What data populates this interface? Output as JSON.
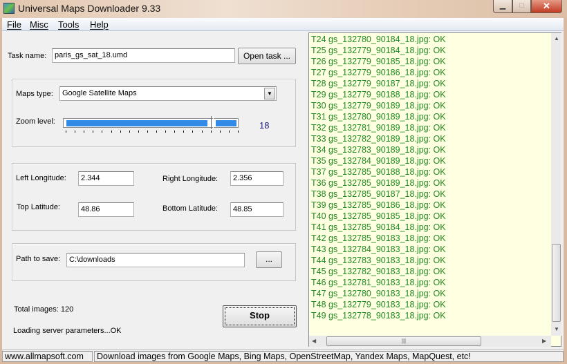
{
  "window": {
    "title": "Universal Maps Downloader 9.33",
    "minimize": "▁",
    "maximize": "□",
    "close": "✕"
  },
  "menu": [
    "File",
    "Misc",
    "Tools",
    "Help"
  ],
  "task": {
    "label": "Task name:",
    "value": "paris_gs_sat_18.umd",
    "open_button": "Open task ..."
  },
  "maps": {
    "type_label": "Maps type:",
    "type_value": "Google Satellite Maps",
    "zoom_label": "Zoom level:",
    "zoom_value": "18",
    "zoom_min": 0,
    "zoom_max": 19,
    "colors": {
      "slider_fill": "#3289e6",
      "zoom_value": "#1a1a80"
    }
  },
  "coords": {
    "left_lon_label": "Left Longitude:",
    "left_lon": "2.344",
    "right_lon_label": "Right Longitude:",
    "right_lon": "2.356",
    "top_lat_label": "Top Latitude:",
    "top_lat": "48.86",
    "bottom_lat_label": "Bottom Latitude:",
    "bottom_lat": "48.85"
  },
  "path": {
    "label": "Path to save:",
    "value": "C:\\downloads",
    "browse_button": "..."
  },
  "status": {
    "total_images": "Total images: 120",
    "loading": "Loading server parameters...OK",
    "stop_button": "Stop"
  },
  "log": {
    "color": "#1f8a1f",
    "lines": [
      "T24 gs_132780_90184_18.jpg: OK",
      "T25 gs_132779_90184_18.jpg: OK",
      "T26 gs_132779_90185_18.jpg: OK",
      "T27 gs_132779_90186_18.jpg: OK",
      "T28 gs_132779_90187_18.jpg: OK",
      "T29 gs_132779_90188_18.jpg: OK",
      "T30 gs_132779_90189_18.jpg: OK",
      "T31 gs_132780_90189_18.jpg: OK",
      "T32 gs_132781_90189_18.jpg: OK",
      "T33 gs_132782_90189_18.jpg: OK",
      "T34 gs_132783_90189_18.jpg: OK",
      "T35 gs_132784_90189_18.jpg: OK",
      "T37 gs_132785_90188_18.jpg: OK",
      "T36 gs_132785_90189_18.jpg: OK",
      "T38 gs_132785_90187_18.jpg: OK",
      "T39 gs_132785_90186_18.jpg: OK",
      "T40 gs_132785_90185_18.jpg: OK",
      "T41 gs_132785_90184_18.jpg: OK",
      "T42 gs_132785_90183_18.jpg: OK",
      "T43 gs_132784_90183_18.jpg: OK",
      "T44 gs_132783_90183_18.jpg: OK",
      "T45 gs_132782_90183_18.jpg: OK",
      "T46 gs_132781_90183_18.jpg: OK",
      "T47 gs_132780_90183_18.jpg: OK",
      "T48 gs_132779_90183_18.jpg: OK",
      "T49 gs_132778_90183_18.jpg: OK"
    ]
  },
  "statusbar": {
    "website": "www.allmapsoft.com",
    "message": "Download images from Google Maps, Bing Maps, OpenStreetMap, Yandex Maps, MapQuest, etc!"
  }
}
